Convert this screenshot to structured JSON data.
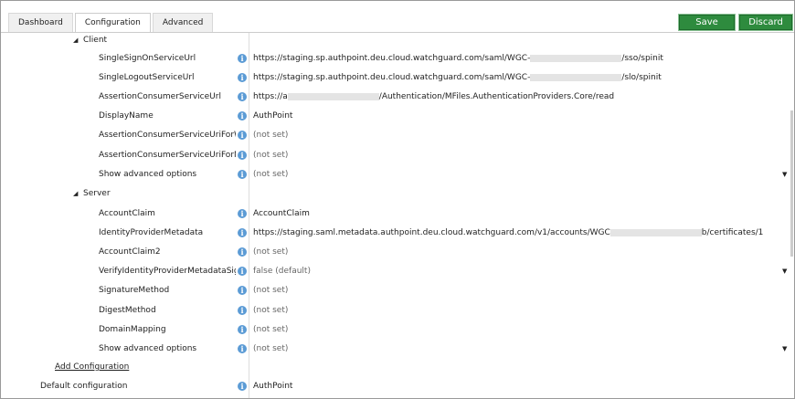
{
  "tabs": [
    "Dashboard",
    "Configuration",
    "Advanced"
  ],
  "buttons": {
    "save": "Save",
    "discard": "Discard"
  },
  "groups": {
    "client": "Client",
    "server": "Server"
  },
  "client_rows": [
    {
      "label": "SingleSignOnServiceUrl",
      "value_prefix": "https://staging.sp.authpoint.deu.cloud.watchguard.com/saml/WGC-",
      "value_suffix": "/sso/spinit"
    },
    {
      "label": "SingleLogoutServiceUrl",
      "value_prefix": "https://staging.sp.authpoint.deu.cloud.watchguard.com/saml/WGC-",
      "value_suffix": "/slo/spinit"
    },
    {
      "label": "AssertionConsumerServiceUrl",
      "value_prefix": "https://a",
      "value_suffix": "/Authentication/MFiles.AuthenticationProviders.Core/read"
    },
    {
      "label": "DisplayName",
      "value": "AuthPoint"
    },
    {
      "label": "AssertionConsumerServiceUriForWeb",
      "value": "(not set)"
    },
    {
      "label": "AssertionConsumerServiceUriForNat...",
      "value": "(not set)"
    },
    {
      "label": "Show advanced options",
      "value": "(not set)"
    }
  ],
  "server_rows": [
    {
      "label": "AccountClaim",
      "value": "AccountClaim"
    },
    {
      "label": "IdentityProviderMetadata",
      "value_prefix": "https://staging.saml.metadata.authpoint.deu.cloud.watchguard.com/v1/accounts/WGC",
      "value_suffix": "b/certificates/1"
    },
    {
      "label": "AccountClaim2",
      "value": "(not set)"
    },
    {
      "label": "VerifyIdentityProviderMetadataSign...",
      "value": "false (default)"
    },
    {
      "label": "SignatureMethod",
      "value": "(not set)"
    },
    {
      "label": "DigestMethod",
      "value": "(not set)"
    },
    {
      "label": "DomainMapping",
      "value": "(not set)"
    },
    {
      "label": "Show advanced options",
      "value": "(not set)"
    }
  ],
  "add_configuration": "Add Configuration",
  "default_configuration": {
    "label": "Default configuration",
    "value": "AuthPoint"
  }
}
